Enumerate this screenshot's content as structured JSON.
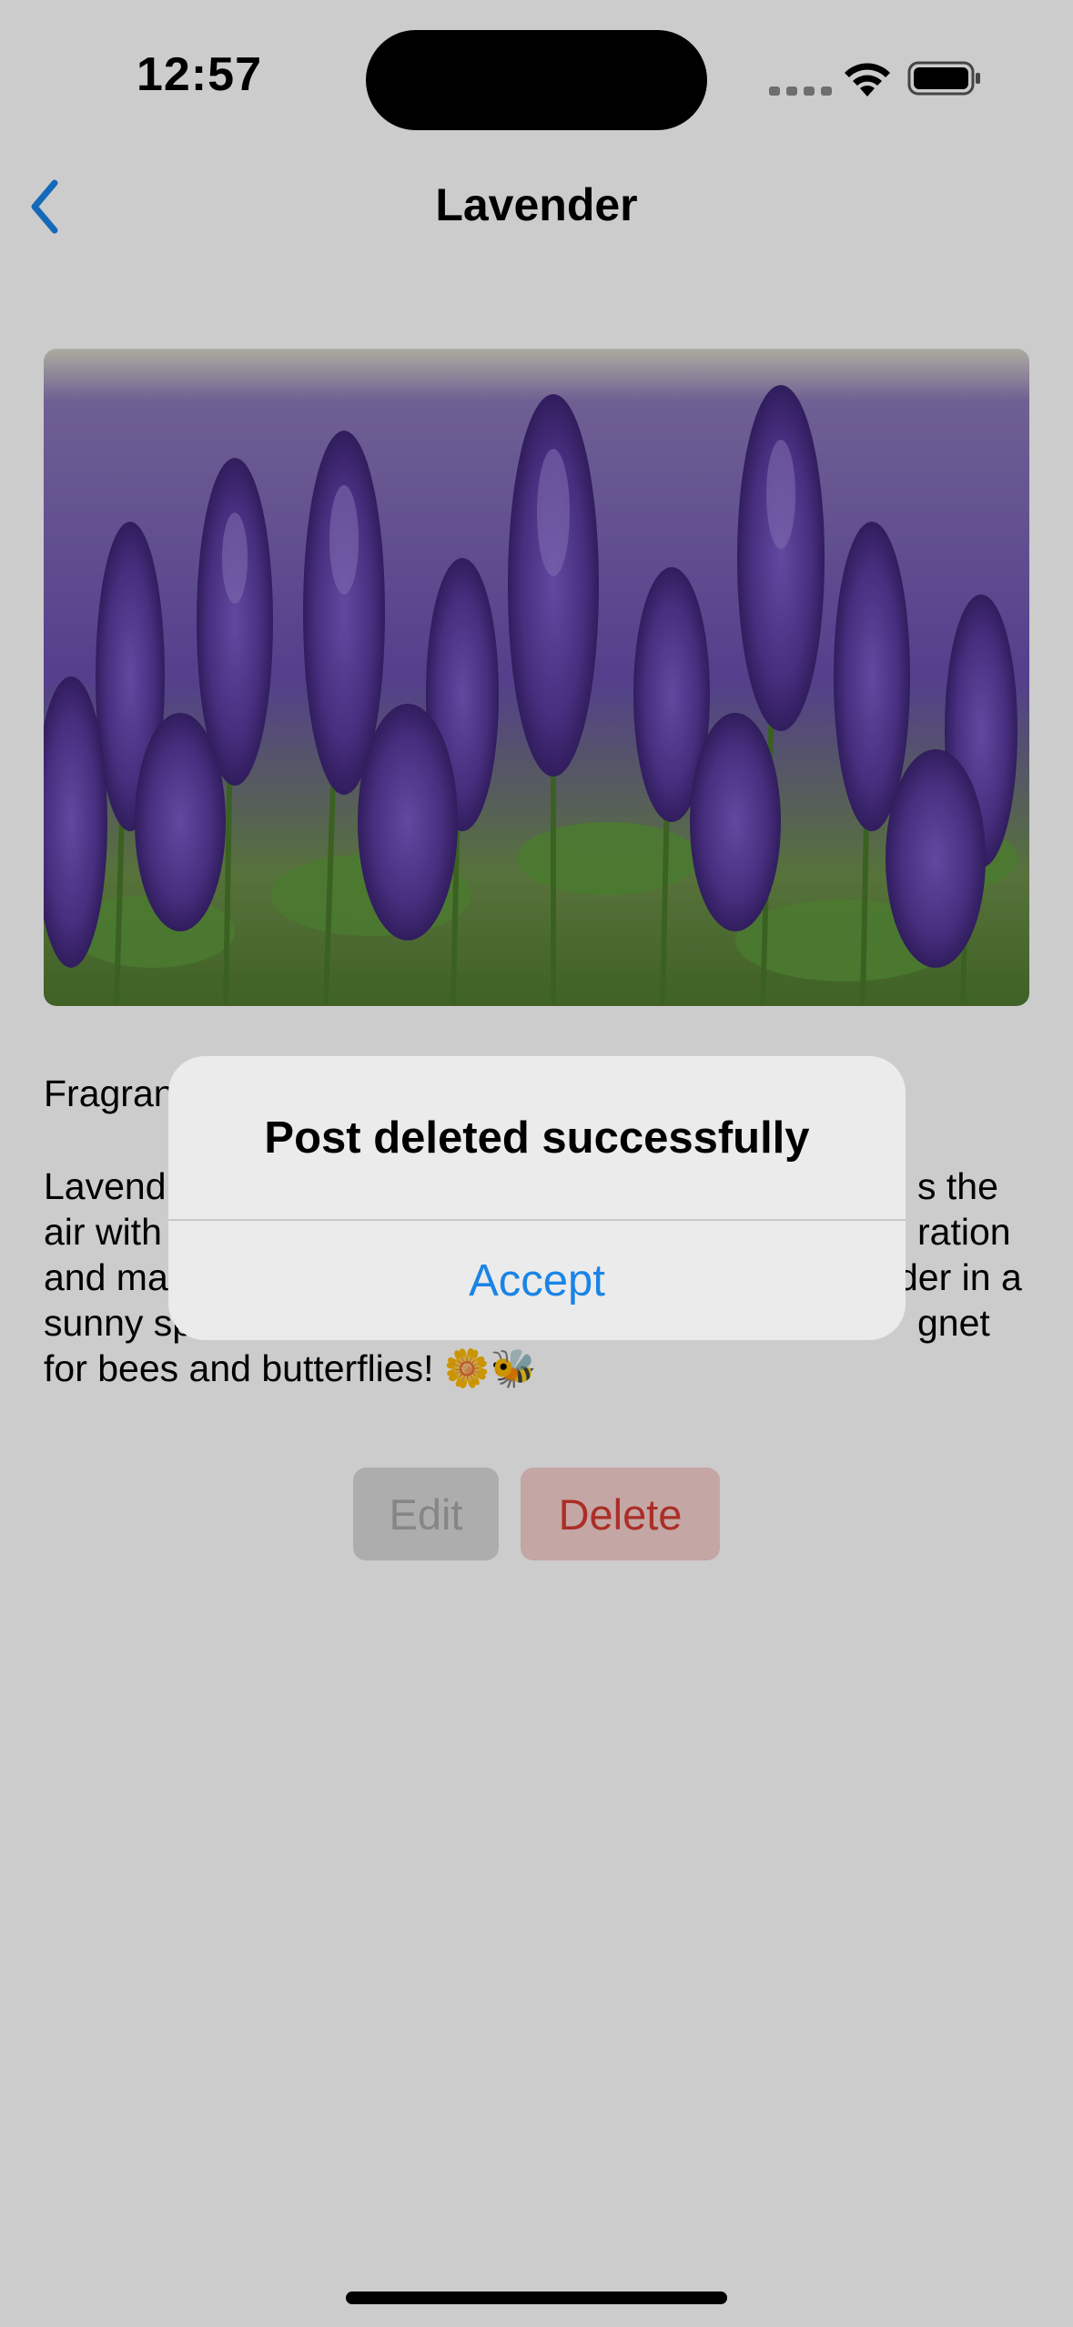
{
  "status_bar": {
    "time": "12:57"
  },
  "nav": {
    "title": "Lavender",
    "back_icon": "chevron-left-icon"
  },
  "post": {
    "image_subject": "lavender-field-photo",
    "subtitle_visible": "Fragran",
    "body_lines": [
      "Lavend",
      "s the",
      "air with",
      "ration",
      "and ma",
      "der in a",
      "sunny sp",
      "gnet",
      "for bees and butterflies! 🌼🐝"
    ]
  },
  "actions": {
    "edit_label": "Edit",
    "delete_label": "Delete"
  },
  "alert": {
    "title": "Post deleted successfully",
    "accept_label": "Accept"
  },
  "colors": {
    "accent": "#1a84e6",
    "destructive": "#d63a31"
  }
}
